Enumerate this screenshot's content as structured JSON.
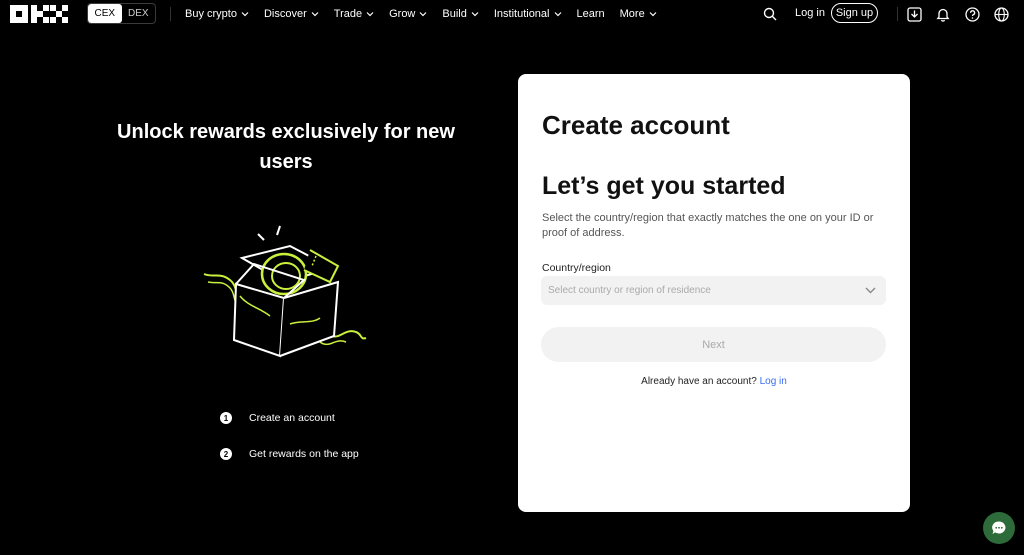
{
  "nav": {
    "switch": {
      "cex": "CEX",
      "dex": "DEX"
    },
    "menu": [
      {
        "label": "Buy crypto",
        "dropdown": true
      },
      {
        "label": "Discover",
        "dropdown": true
      },
      {
        "label": "Trade",
        "dropdown": true
      },
      {
        "label": "Grow",
        "dropdown": true
      },
      {
        "label": "Build",
        "dropdown": true
      },
      {
        "label": "Institutional",
        "dropdown": true
      },
      {
        "label": "Learn",
        "dropdown": false
      },
      {
        "label": "More",
        "dropdown": true
      }
    ],
    "login": "Log in",
    "signup": "Sign up",
    "icons": [
      "search-icon",
      "download-icon",
      "bell-icon",
      "help-icon",
      "globe-icon"
    ]
  },
  "promo": {
    "title": "Unlock rewards exclusively for new users",
    "steps": [
      {
        "num": "1",
        "label": "Create an account"
      },
      {
        "num": "2",
        "label": "Get rewards on the app"
      }
    ]
  },
  "form": {
    "title": "Create account",
    "subtitle": "Let’s get you started",
    "description": "Select the country/region that exactly matches the one on your ID or proof of address.",
    "country_label": "Country/region",
    "country_placeholder": "Select country or region of residence",
    "next": "Next",
    "already": "Already have an account?",
    "login_link": "Log in"
  },
  "colors": {
    "accent_green": "#c8f03c",
    "link_blue": "#3a6cf4",
    "chat_green": "#2e6b3a"
  }
}
